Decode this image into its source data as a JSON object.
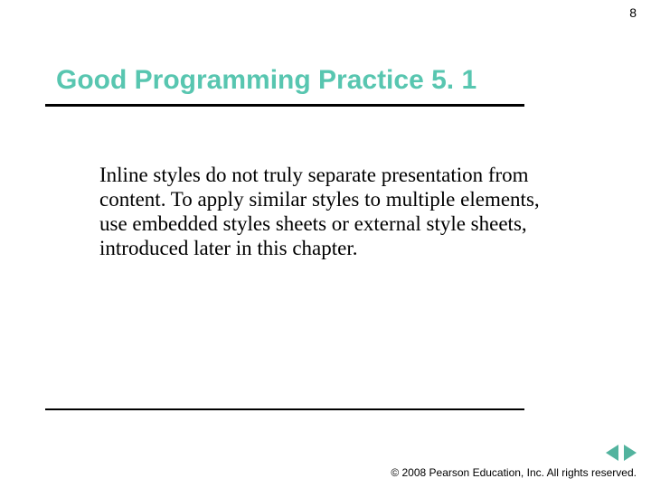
{
  "page_number": "8",
  "title": "Good Programming Practice 5. 1",
  "body": "Inline styles do not truly separate presentation from content. To apply similar styles to multiple elements, use embedded styles sheets or external style sheets, introduced later in this chapter.",
  "footer": "© 2008 Pearson Education, Inc.  All rights reserved.",
  "nav": {
    "prev": "previous-slide",
    "next": "next-slide"
  }
}
